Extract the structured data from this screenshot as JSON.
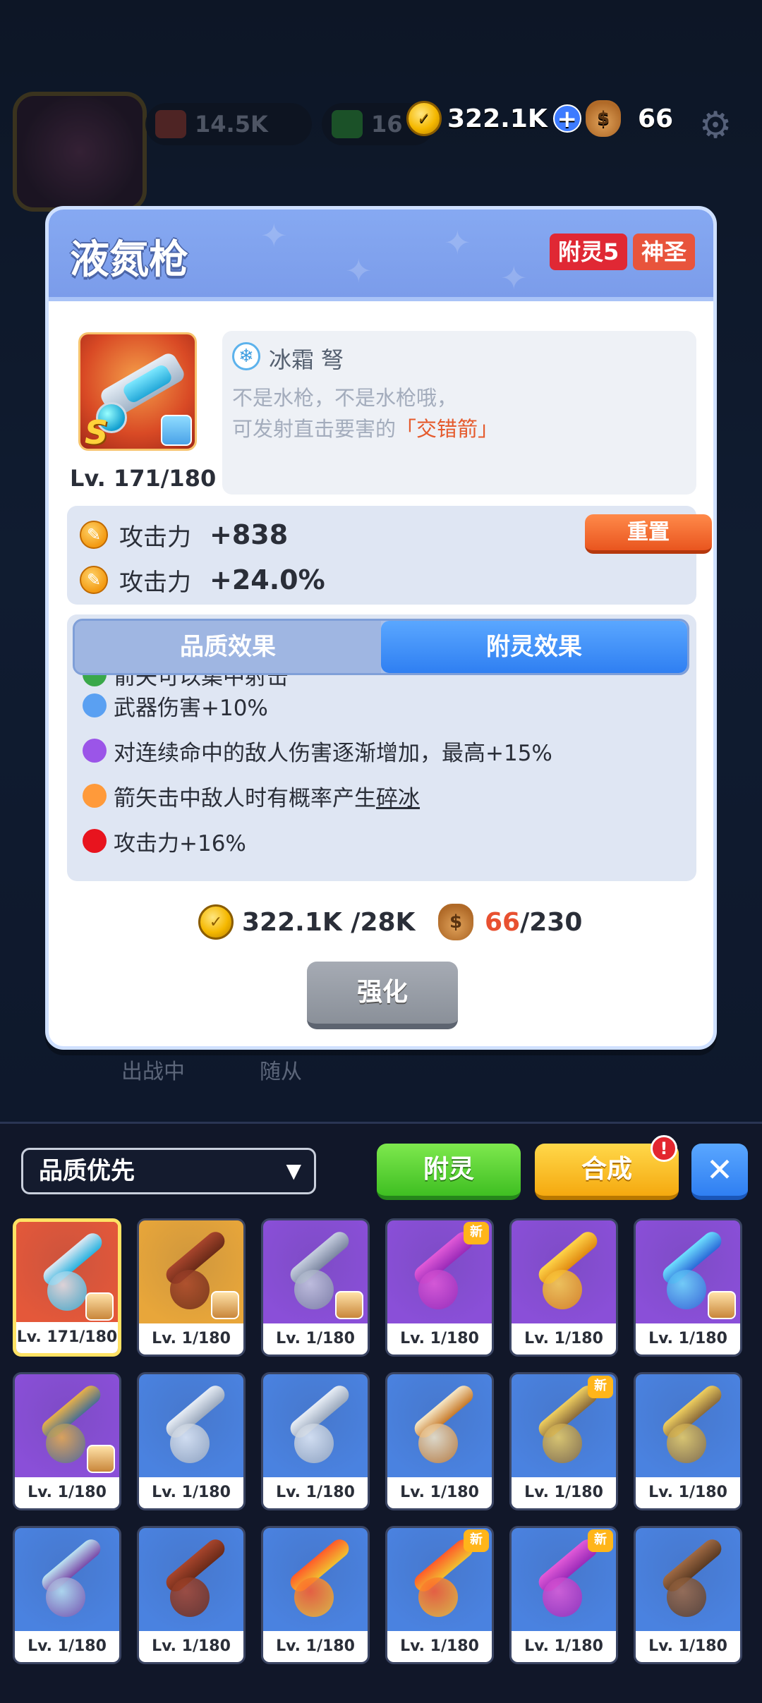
{
  "hud": {
    "resource_1": "14.5K",
    "resource_2": "16",
    "coins": "322.1K",
    "bags": "66",
    "background_label_1": "出战中",
    "background_label_2": "随从"
  },
  "weapon": {
    "name": "液氮枪",
    "badge_enchant": "附灵5",
    "badge_quality": "神圣",
    "rank": "S",
    "level": "Lv. 171/180",
    "type": "冰霜 弩",
    "desc_line1": "不是水枪，不是水枪哦，",
    "desc_line2_prefix": "可发射直击要害的",
    "desc_line2_highlight": "「交错箭」",
    "stats": [
      {
        "name": "攻击力",
        "value": "+838"
      },
      {
        "name": "攻击力",
        "value": "+24.0%"
      }
    ],
    "reset_label": "重置",
    "tabs": {
      "quality": "品质效果",
      "enchant": "附灵效果",
      "active": "enchant"
    },
    "effects": [
      {
        "color": "#3aa84a",
        "text": "箭矢可以集中射击",
        "keyword": ""
      },
      {
        "color": "#5aa0f2",
        "text": "武器伤害+10%",
        "keyword": ""
      },
      {
        "color": "#9b55e8",
        "text": "对连续命中的敌人伤害逐渐增加，最高+15%",
        "keyword": ""
      },
      {
        "color": "#ff9a3a",
        "text": "箭矢击中敌人时有概率产生",
        "keyword": "碎冰"
      },
      {
        "color": "#e8141e",
        "text": "攻击力+16%",
        "keyword": ""
      }
    ],
    "cost_coins": "322.1K /28K",
    "cost_bags_have": "66",
    "cost_bags_need": "/230",
    "upgrade_label": "强化"
  },
  "inventory": {
    "sort_label": "品质优先",
    "enchant_button": "附灵",
    "merge_button": "合成",
    "merge_alert": "!",
    "close_icon": "close-icon",
    "new_tag": "新",
    "items": [
      {
        "level": "Lv. 171/180",
        "bg": "#e4583a",
        "weapon": "liquid-nitrogen-gun",
        "hero": true,
        "new": false,
        "selected": true
      },
      {
        "level": "Lv. 1/180",
        "bg": "#e8a63a",
        "weapon": "club",
        "hero": true,
        "new": false,
        "selected": false
      },
      {
        "level": "Lv. 1/180",
        "bg": "#8a4fd8",
        "weapon": "blade",
        "hero": true,
        "new": false,
        "selected": false
      },
      {
        "level": "Lv. 1/180",
        "bg": "#8a4fd8",
        "weapon": "dragon-staff",
        "hero": false,
        "new": true,
        "selected": false
      },
      {
        "level": "Lv. 1/180",
        "bg": "#8a4fd8",
        "weapon": "lightning-bow",
        "hero": false,
        "new": false,
        "selected": false
      },
      {
        "level": "Lv. 1/180",
        "bg": "#8a4fd8",
        "weapon": "ice-crossbow",
        "hero": true,
        "new": false,
        "selected": false
      },
      {
        "level": "Lv. 1/180",
        "bg": "#8a4fd8",
        "weapon": "golden-bow",
        "hero": true,
        "new": false,
        "selected": false
      },
      {
        "level": "Lv. 1/180",
        "bg": "#4a82e0",
        "weapon": "twin-blades",
        "hero": false,
        "new": false,
        "selected": false
      },
      {
        "level": "Lv. 1/180",
        "bg": "#4a82e0",
        "weapon": "twin-blades",
        "hero": false,
        "new": false,
        "selected": false
      },
      {
        "level": "Lv. 1/180",
        "bg": "#4a82e0",
        "weapon": "spear-bow",
        "hero": false,
        "new": false,
        "selected": false
      },
      {
        "level": "Lv. 1/180",
        "bg": "#4a82e0",
        "weapon": "axe",
        "hero": false,
        "new": true,
        "selected": false
      },
      {
        "level": "Lv. 1/180",
        "bg": "#4a82e0",
        "weapon": "axe",
        "hero": false,
        "new": false,
        "selected": false
      },
      {
        "level": "Lv. 1/180",
        "bg": "#4a82e0",
        "weapon": "scythe",
        "hero": false,
        "new": false,
        "selected": false
      },
      {
        "level": "Lv. 1/180",
        "bg": "#4a82e0",
        "weapon": "club",
        "hero": false,
        "new": false,
        "selected": false
      },
      {
        "level": "Lv. 1/180",
        "bg": "#4a82e0",
        "weapon": "fire-bow",
        "hero": false,
        "new": false,
        "selected": false
      },
      {
        "level": "Lv. 1/180",
        "bg": "#4a82e0",
        "weapon": "fire-bow",
        "hero": false,
        "new": true,
        "selected": false
      },
      {
        "level": "Lv. 1/180",
        "bg": "#4a82e0",
        "weapon": "dragon-staff",
        "hero": false,
        "new": true,
        "selected": false
      },
      {
        "level": "Lv. 1/180",
        "bg": "#4a82e0",
        "weapon": "crossbow",
        "hero": false,
        "new": false,
        "selected": false
      }
    ]
  },
  "colors": {
    "modal_header": "#7b9cea",
    "reset": "#e9551f",
    "tab_active": "#2f7ff2",
    "enchant_green": "#3fbf22",
    "merge_yellow": "#f5a90f",
    "cost_highlight": "#e85030"
  }
}
